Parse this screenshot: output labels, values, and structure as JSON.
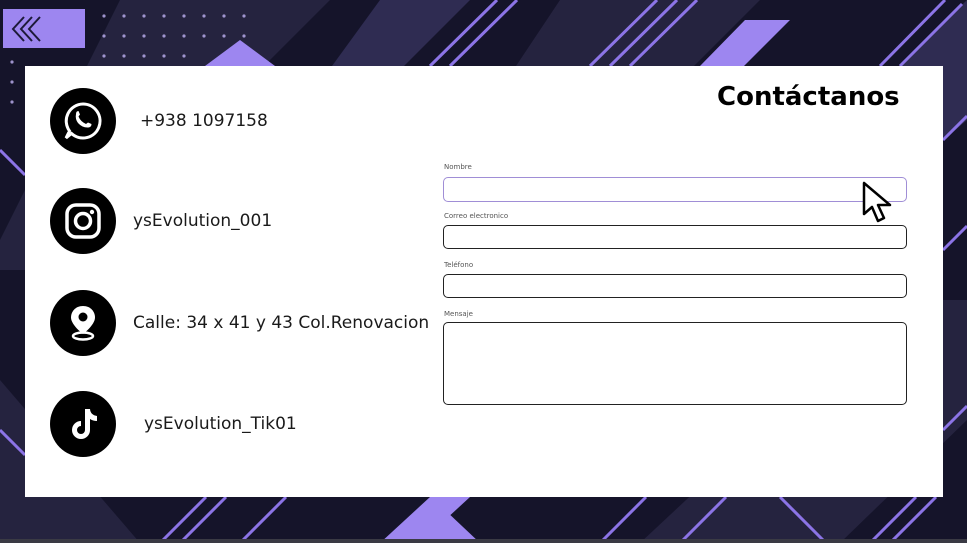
{
  "contacts": {
    "phone": "+938 1097158",
    "instagram": "ysEvolution_001",
    "address": "Calle: 34 x 41 y 43 Col.Renovacion",
    "tiktok": "ysEvolution_Tik01"
  },
  "form": {
    "title": "Contáctanos",
    "name_label": "Nombre",
    "email_label": "Correo electronico",
    "phone_label": "Teléfono",
    "message_label": "Mensaje",
    "name_value": "",
    "email_value": "",
    "phone_value": "",
    "message_value": ""
  },
  "icons": {
    "back": "double-chevron-left-icon",
    "whatsapp": "whatsapp-icon",
    "instagram": "instagram-icon",
    "location": "location-pin-icon",
    "tiktok": "tiktok-icon",
    "cursor": "mouse-cursor-icon"
  },
  "colors": {
    "background": "#15142a",
    "accent": "#9d86f0",
    "card": "#ffffff",
    "icon_circle": "#000000"
  }
}
